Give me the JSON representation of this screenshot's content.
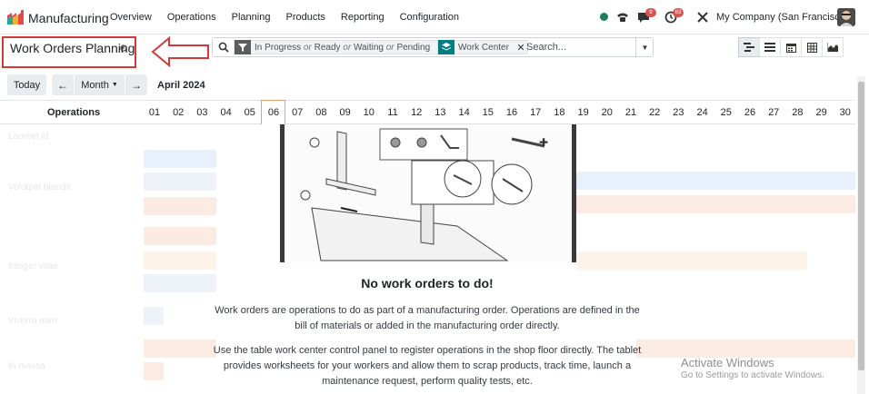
{
  "navbar": {
    "app_name": "Manufacturing",
    "menu": [
      "Overview",
      "Operations",
      "Planning",
      "Products",
      "Reporting",
      "Configuration"
    ],
    "messages_badge": "9",
    "activities_badge": "63",
    "company": "My Company (San Francisco)"
  },
  "control_panel": {
    "title": "Work Orders Planning",
    "facet_status": {
      "parts": [
        "In Progress",
        "or",
        "Ready",
        "or",
        "Waiting",
        "or",
        "Pending"
      ]
    },
    "facet_group": "Work Center",
    "search_placeholder": "Search..."
  },
  "date_nav": {
    "today": "Today",
    "prev": "←",
    "scale": "Month",
    "next": "→",
    "period": "April 2024"
  },
  "gantt": {
    "operations_header": "Operations",
    "days": [
      "01",
      "02",
      "03",
      "04",
      "05",
      "06",
      "07",
      "08",
      "09",
      "10",
      "11",
      "12",
      "13",
      "14",
      "15",
      "16",
      "17",
      "18",
      "19",
      "20",
      "21",
      "22",
      "23",
      "24",
      "25",
      "26",
      "27",
      "28",
      "29",
      "30"
    ],
    "today_day": "06",
    "rows": [
      "Laoreet id",
      "Volutpat blandit",
      "Integer vitae",
      "Viverra nam",
      "In massa"
    ]
  },
  "empty_state": {
    "title": "No work orders to do!",
    "paragraph1": "Work orders are operations to do as part of a manufacturing order. Operations are defined in the bill of materials or added in the manufacturing order directly.",
    "paragraph2": "Use the table work center control panel to register operations in the shop floor directly. The tablet provides worksheets for your workers and allow them to scrap products, track time, launch a maintenance request, perform quality tests, etc."
  },
  "watermark": {
    "title": "Activate Windows",
    "subtitle": "Go to Settings to activate Windows."
  },
  "colors": {
    "accent_teal": "#017e84",
    "annotation_red": "#d23a3a",
    "today_border": "#e8a16a"
  }
}
